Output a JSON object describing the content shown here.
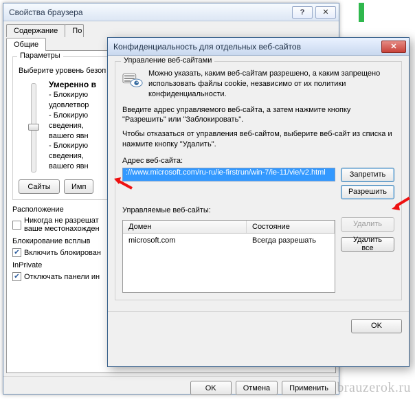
{
  "parent": {
    "title": "Свойства браузера",
    "tabs_row1": [
      "Содержание",
      "По"
    ],
    "tabs_row2": [
      "Общие"
    ],
    "params_legend": "Параметры",
    "select_level": "Выберите уровень безоп",
    "level_name": "Умеренно в",
    "bullets": [
      "- Блокирую",
      "удовлетвор",
      "- Блокирую",
      "сведения, ",
      "вашего явн",
      "- Блокирую",
      "сведения, ",
      "вашего явн"
    ],
    "sites_btn": "Сайты",
    "imp_btn": "Имп",
    "location_label": "Расположение",
    "never_allow": "Никогда не разрешат",
    "your_location": "ваше местонахожден",
    "blocking_label": "Блокирование всплыв",
    "enable_blocking": "Включить блокирован",
    "inprivate_label": "InPrivate",
    "disable_panels": "Отключать панели ин",
    "ok": "OK",
    "cancel": "Отмена",
    "apply": "Применить"
  },
  "child": {
    "title": "Конфиденциальность для отдельных веб-сайтов",
    "group_legend": "Управление веб-сайтами",
    "info1": "Можно указать, каким веб-сайтам разрешено, а каким запрещено использовать файлы cookie, независимо от их политики конфиденциальности.",
    "info2": "Введите адрес управляемого веб-сайта, а затем нажмите кнопку \"Разрешить\" или \"Заблокировать\".",
    "info3": "Чтобы отказаться от управления веб-сайтом, выберите веб-сайт из списка и нажмите кнопку \"Удалить\".",
    "address_label": "Адрес веб-сайта:",
    "address_value": "://www.microsoft.com/ru-ru/ie-firstrun/win-7/ie-11/vie/v2.html",
    "block_btn": "Запретить",
    "allow_btn": "Разрешить",
    "managed_label": "Управляемые веб-сайты:",
    "col_domain": "Домен",
    "col_state": "Состояние",
    "row_domain": "microsoft.com",
    "row_state": "Всегда разрешать",
    "delete_btn": "Удалить",
    "delete_all_btn": "Удалить все",
    "ok": "OK"
  },
  "watermark": "brauzerok.ru"
}
